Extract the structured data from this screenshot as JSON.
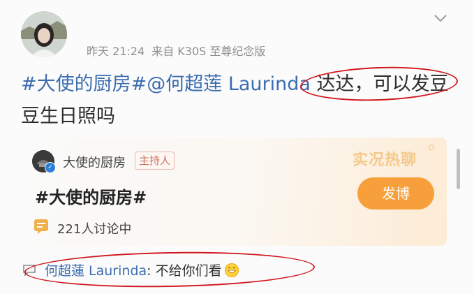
{
  "post": {
    "time": "昨天 21:24",
    "source": "来自 K30S 至尊纪念版",
    "topic": "#大使的厨房#",
    "mention": "@何超莲 Laurinda",
    "text": " 达达，可以发豆豆生日照吗"
  },
  "card": {
    "account_name": "大使的厨房",
    "host_badge": "主持人",
    "live_tag": "实况热聊",
    "title": "#大使的厨房#",
    "post_button": "发博",
    "discussion": "221人讨论中"
  },
  "comment": {
    "author": "何超蓮 Laurinda",
    "text": ": 不给你们看"
  },
  "colors": {
    "link": "#3c6db0",
    "accent": "#f79f3b",
    "annotation": "#d0171d"
  }
}
